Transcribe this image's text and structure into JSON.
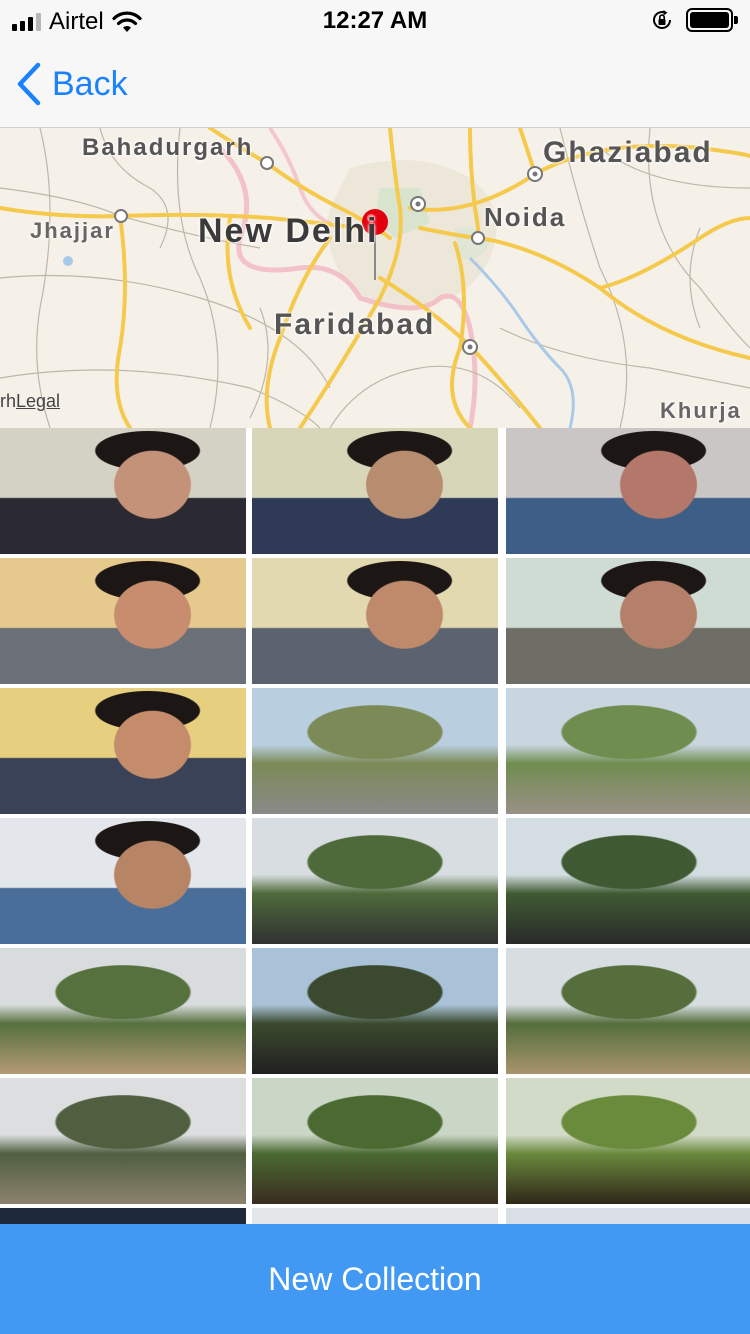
{
  "status_bar": {
    "carrier": "Airtel",
    "time": "12:27 AM",
    "signal_bars": 4,
    "signal_strength": 3,
    "battery_level": 0.95,
    "icons": [
      "wifi-icon",
      "rotation-lock-icon",
      "battery-icon"
    ]
  },
  "nav": {
    "back_label": "Back",
    "accent_color": "#1a82fb"
  },
  "map": {
    "labels": {
      "bahadurgarh": "Bahadurgarh",
      "ghaziabad": "Ghaziabad",
      "jhajjar": "Jhajjar",
      "new_delhi": "New Delhi",
      "noida": "Noida",
      "faridabad": "Faridabad",
      "khurja": "Khurja",
      "legal_prefix": "rh",
      "legal": "Legal"
    },
    "pin": "map-pin-icon",
    "pin_color": "#e3000f"
  },
  "photos": [
    {
      "name": "photo-selfie-1",
      "type": "portrait",
      "colors": [
        "#d4d2c4",
        "#2b2a33",
        "#c49279"
      ]
    },
    {
      "name": "photo-selfie-2",
      "type": "portrait",
      "colors": [
        "#d8d6b8",
        "#2e3a56",
        "#b88c6e"
      ]
    },
    {
      "name": "photo-selfie-3",
      "type": "portrait",
      "colors": [
        "#c9c6c5",
        "#3d5e86",
        "#b4786a"
      ]
    },
    {
      "name": "photo-selfie-4",
      "type": "portrait",
      "colors": [
        "#e6c98c",
        "#6b6f77",
        "#c88d6e"
      ]
    },
    {
      "name": "photo-selfie-5",
      "type": "portrait",
      "colors": [
        "#e3d9b1",
        "#5b6370",
        "#bf8a6b"
      ]
    },
    {
      "name": "photo-selfie-6",
      "type": "portrait",
      "colors": [
        "#cfdcd4",
        "#6e6e66",
        "#b58069"
      ]
    },
    {
      "name": "photo-selfie-7",
      "type": "portrait",
      "colors": [
        "#e6cf7e",
        "#3a4258",
        "#c58c6c"
      ]
    },
    {
      "name": "photo-park-path-1",
      "type": "landscape",
      "colors": [
        "#b9cfe0",
        "#7b8a56",
        "#8a8a8a"
      ]
    },
    {
      "name": "photo-park-path-2",
      "type": "landscape",
      "colors": [
        "#c9d6e0",
        "#6f8d4e",
        "#9a9088"
      ]
    },
    {
      "name": "photo-selfie-8",
      "type": "portrait",
      "colors": [
        "#e3e6ea",
        "#4a6e9a",
        "#b78566"
      ]
    },
    {
      "name": "photo-gazebo-1",
      "type": "landscape",
      "colors": [
        "#d7dde0",
        "#4e6a3a",
        "#313131"
      ]
    },
    {
      "name": "photo-gazebo-2",
      "type": "landscape",
      "colors": [
        "#d3dde2",
        "#3f5a33",
        "#2a2a2a"
      ]
    },
    {
      "name": "photo-park-tree-1",
      "type": "landscape",
      "colors": [
        "#d8dcdc",
        "#56703e",
        "#b49a76"
      ]
    },
    {
      "name": "photo-park-tree-2",
      "type": "landscape",
      "colors": [
        "#a9c2d8",
        "#3b4a2e",
        "#202020"
      ]
    },
    {
      "name": "photo-park-tree-3",
      "type": "landscape",
      "colors": [
        "#d7dde0",
        "#556e3c",
        "#a8946e"
      ]
    },
    {
      "name": "photo-park-wide-1",
      "type": "landscape",
      "colors": [
        "#dcdedf",
        "#4f5f40",
        "#8c826e"
      ]
    },
    {
      "name": "photo-pergola-1",
      "type": "landscape",
      "colors": [
        "#cad6c6",
        "#4b6a32",
        "#3a2c20"
      ]
    },
    {
      "name": "photo-pergola-2",
      "type": "landscape",
      "colors": [
        "#d2dbc8",
        "#6a8a3c",
        "#2f2519"
      ]
    },
    {
      "name": "photo-partial-1",
      "type": "landscape",
      "colors": [
        "#1e2a3a",
        "#101820",
        "#2a2a2a"
      ]
    },
    {
      "name": "photo-partial-2",
      "type": "landscape",
      "colors": [
        "#e4e7ea",
        "#3a4046",
        "#202326"
      ]
    },
    {
      "name": "photo-partial-3",
      "type": "landscape",
      "colors": [
        "#d9dfe4",
        "#4a4f53",
        "#262a2d"
      ]
    }
  ],
  "bottom": {
    "new_collection_label": "New Collection",
    "button_color": "#4199f4"
  }
}
